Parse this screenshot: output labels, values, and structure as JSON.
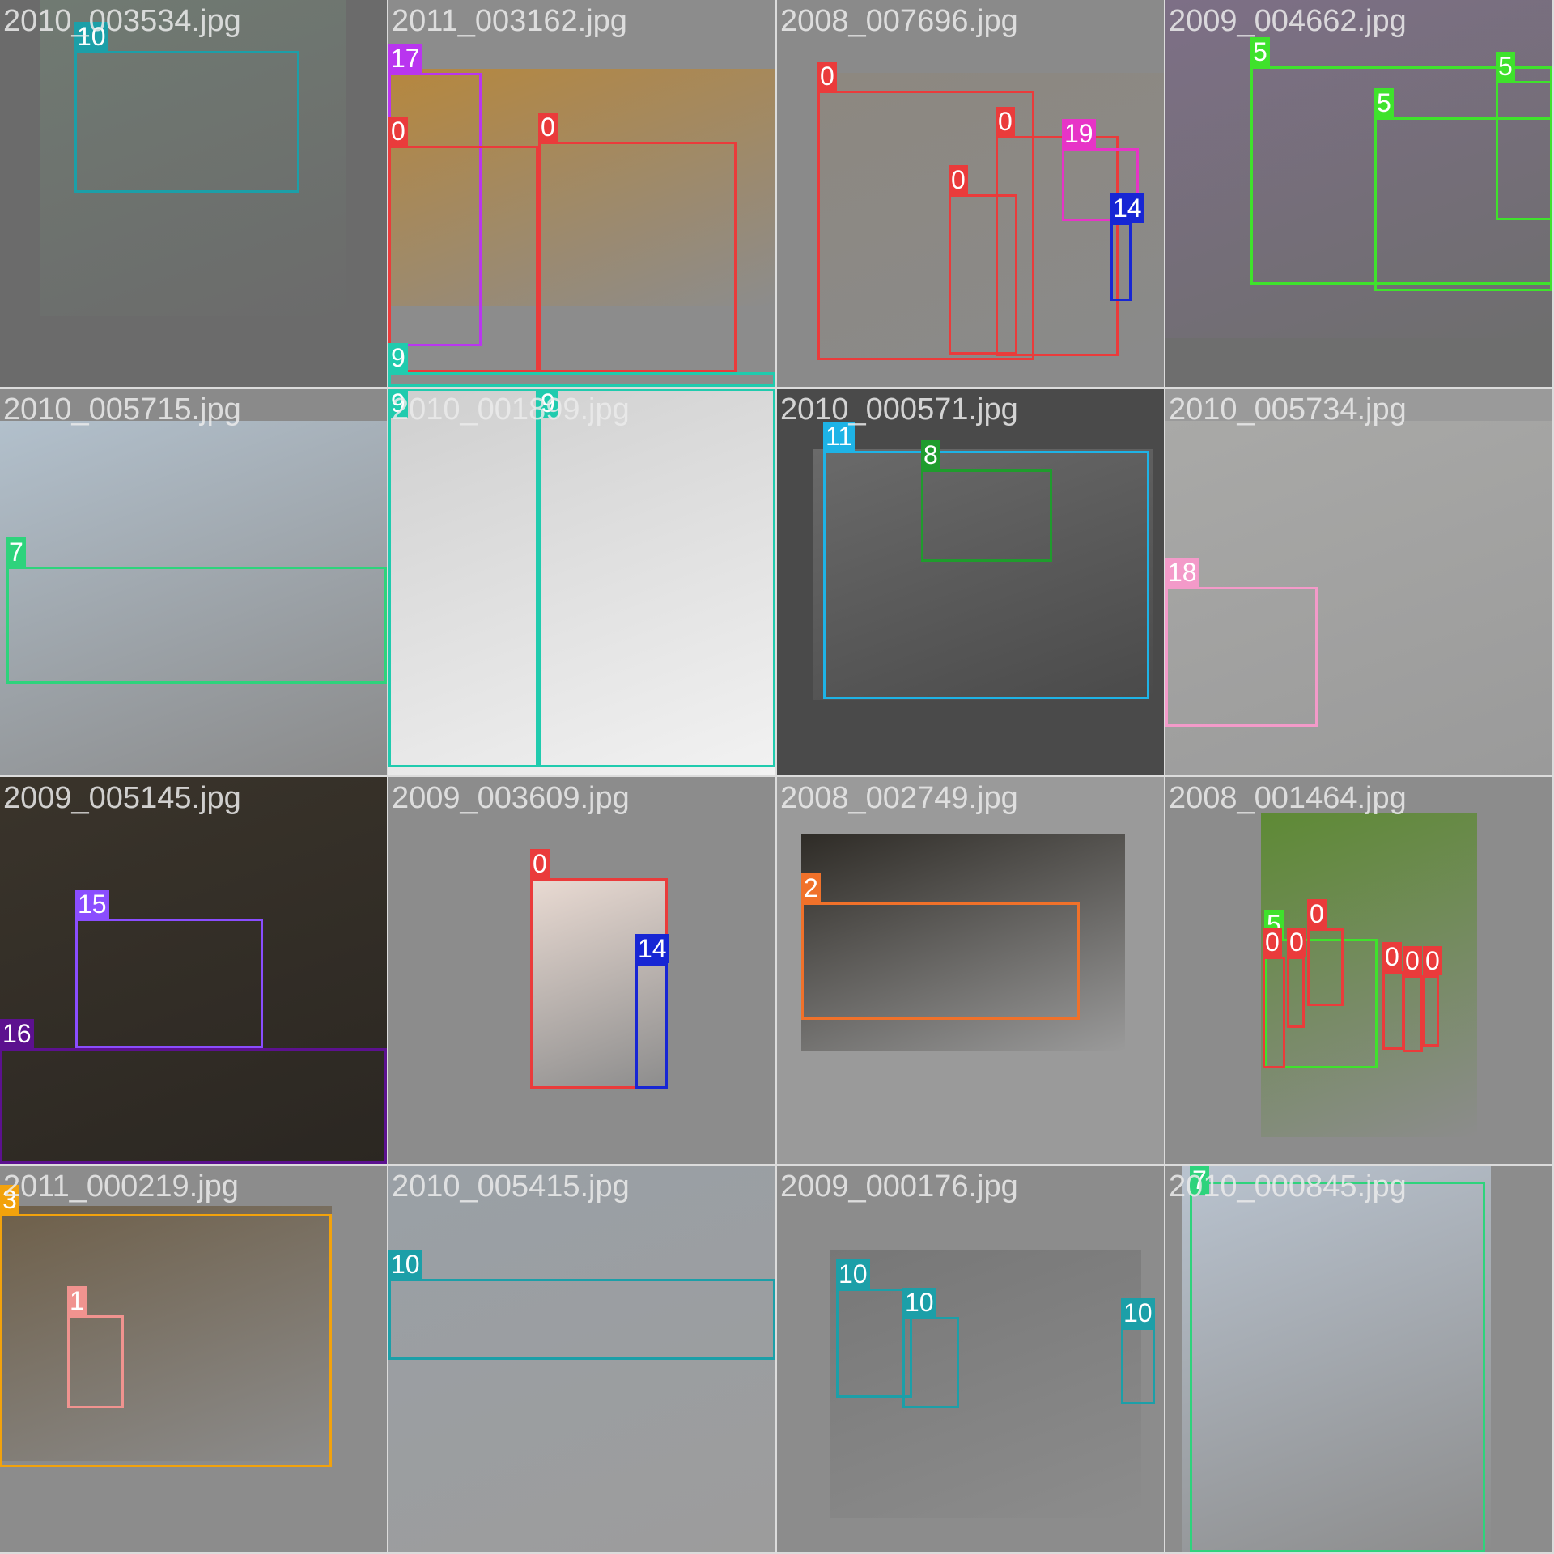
{
  "colors": {
    "0": "#ea3b3b",
    "1": "#f0938f",
    "2": "#f0712a",
    "3": "#f2a20c",
    "5": "#3fe22c",
    "7": "#2ed37c",
    "8": "#1f9c2d",
    "9": "#20cbae",
    "10": "#1c9fa8",
    "11": "#1eb3e6",
    "14": "#1726d4",
    "15": "#8a4dff",
    "16": "#5c118f",
    "17": "#b935ef",
    "18": "#f39ac9",
    "19": "#e734c7"
  },
  "tiles": [
    {
      "filename": "2010_003534.jpg",
      "bg": "#6b6b6b",
      "photo": "#707a72",
      "boxes": [
        {
          "label": "10"
        }
      ]
    },
    {
      "filename": "2011_003162.jpg",
      "bg": "#8c8c8c",
      "photo": "#b6873e",
      "boxes": [
        {
          "label": "17"
        },
        {
          "label": "0"
        },
        {
          "label": "0"
        },
        {
          "label": "9"
        }
      ]
    },
    {
      "filename": "2008_007696.jpg",
      "bg": "#8a8a8a",
      "photo": "#8d8880",
      "boxes": [
        {
          "label": "0"
        },
        {
          "label": "0"
        },
        {
          "label": "0"
        },
        {
          "label": "19"
        },
        {
          "label": "14"
        }
      ]
    },
    {
      "filename": "2009_004662.jpg",
      "bg": "#6e6e6e",
      "photo": "#7d6f86",
      "boxes": [
        {
          "label": "5"
        },
        {
          "label": "5"
        },
        {
          "label": "5"
        }
      ]
    },
    {
      "filename": "2010_005715.jpg",
      "bg": "#8a8a8a",
      "photo": "#b2c0cc",
      "boxes": [
        {
          "label": "7"
        }
      ]
    },
    {
      "filename": "2010_001899.jpg",
      "bg": "#f2f2f2",
      "photo": "#cfcfcf",
      "boxes": [
        {
          "label": "9"
        },
        {
          "label": "9"
        }
      ]
    },
    {
      "filename": "2010_000571.jpg",
      "bg": "#4a4a4a",
      "photo": "#6a6a6a",
      "boxes": [
        {
          "label": "11"
        },
        {
          "label": "8"
        }
      ]
    },
    {
      "filename": "2010_005734.jpg",
      "bg": "#9a9a9a",
      "photo": "#a9a9a7",
      "boxes": [
        {
          "label": "18"
        }
      ]
    },
    {
      "filename": "2009_005145.jpg",
      "bg": "#2b2722",
      "photo": "#3a342b",
      "boxes": [
        {
          "label": "15"
        },
        {
          "label": "16"
        }
      ]
    },
    {
      "filename": "2009_003609.jpg",
      "bg": "#8c8c8c",
      "photo": "#eadbd3",
      "boxes": [
        {
          "label": "0"
        },
        {
          "label": "14"
        }
      ]
    },
    {
      "filename": "2008_002749.jpg",
      "bg": "#9a9a9a",
      "photo": "#2e2b26",
      "boxes": [
        {
          "label": "2"
        }
      ]
    },
    {
      "filename": "2008_001464.jpg",
      "bg": "#8c8c8c",
      "photo": "#5e8a35",
      "boxes": [
        {
          "label": "5"
        },
        {
          "label": "0"
        },
        {
          "label": "0"
        },
        {
          "label": "0"
        },
        {
          "label": "0"
        },
        {
          "label": "0"
        },
        {
          "label": "0"
        }
      ]
    },
    {
      "filename": "2011_000219.jpg",
      "bg": "#8c8c8c",
      "photo": "#6e5f49",
      "boxes": [
        {
          "label": "3"
        },
        {
          "label": "1"
        }
      ]
    },
    {
      "filename": "2010_005415.jpg",
      "bg": "#9c9c9c",
      "photo": "#9aa0a6",
      "boxes": [
        {
          "label": "10"
        }
      ]
    },
    {
      "filename": "2009_000176.jpg",
      "bg": "#8c8c8c",
      "photo": "#777777",
      "boxes": [
        {
          "label": "10"
        },
        {
          "label": "10"
        },
        {
          "label": "10"
        }
      ]
    },
    {
      "filename": "2010_000845.jpg",
      "bg": "#8c8c8c",
      "photo": "#b9c3cf",
      "boxes": [
        {
          "label": "7"
        }
      ]
    }
  ]
}
